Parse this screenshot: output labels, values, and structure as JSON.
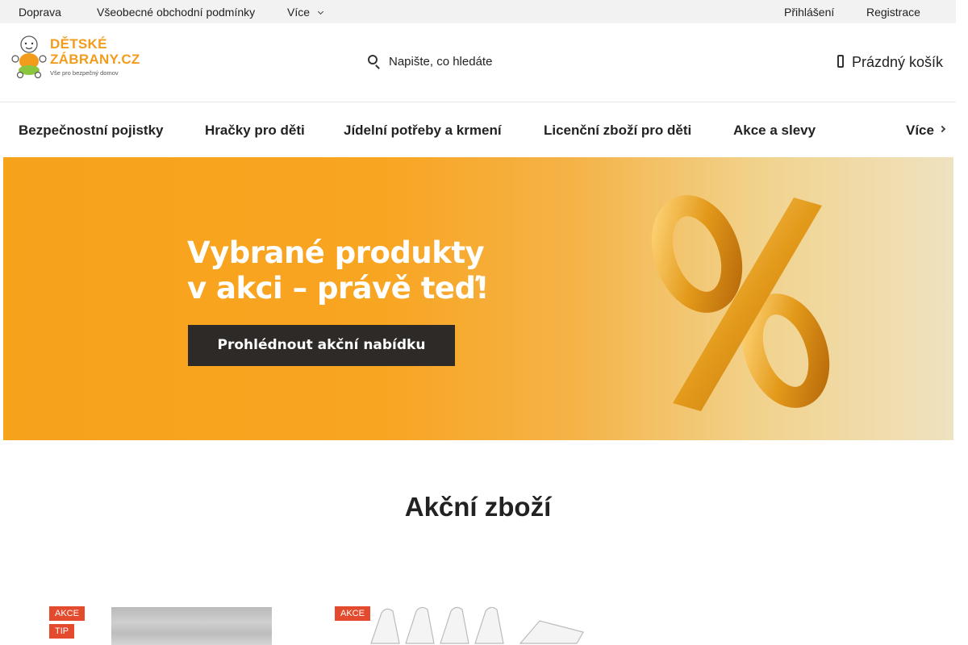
{
  "topbar": {
    "links": [
      "Doprava",
      "Všeobecné obchodní podmínky",
      "Více"
    ],
    "login": "Přihlášení",
    "register": "Registrace"
  },
  "logo": {
    "line1": "DĚTSKÉ",
    "line2": "ZÁBRANY.CZ",
    "tagline": "Vše pro bezpečný domov"
  },
  "search": {
    "placeholder": "Napište, co hledáte"
  },
  "cart": {
    "label": "Prázdný košík"
  },
  "nav": {
    "items": [
      "Bezpečnostní pojistky",
      "Hračky pro děti",
      "Jídelní potřeby a krmení",
      "Licenční zboží pro děti",
      "Akce a slevy"
    ],
    "more": "Více"
  },
  "banner": {
    "line1": "Vybrané produkty",
    "line2": "v akci – právě teď!",
    "button": "Prohlédnout akční nabídku",
    "colors": {
      "background": "#f7a21b",
      "button": "#2d2a28"
    }
  },
  "section": {
    "title": "Akční zboží"
  },
  "products": [
    {
      "badges": [
        "AKCE",
        "TIP"
      ]
    },
    {
      "badges": [
        "AKCE"
      ]
    }
  ],
  "colors": {
    "accent": "#f39c1c",
    "badge": "#e44b2e"
  }
}
